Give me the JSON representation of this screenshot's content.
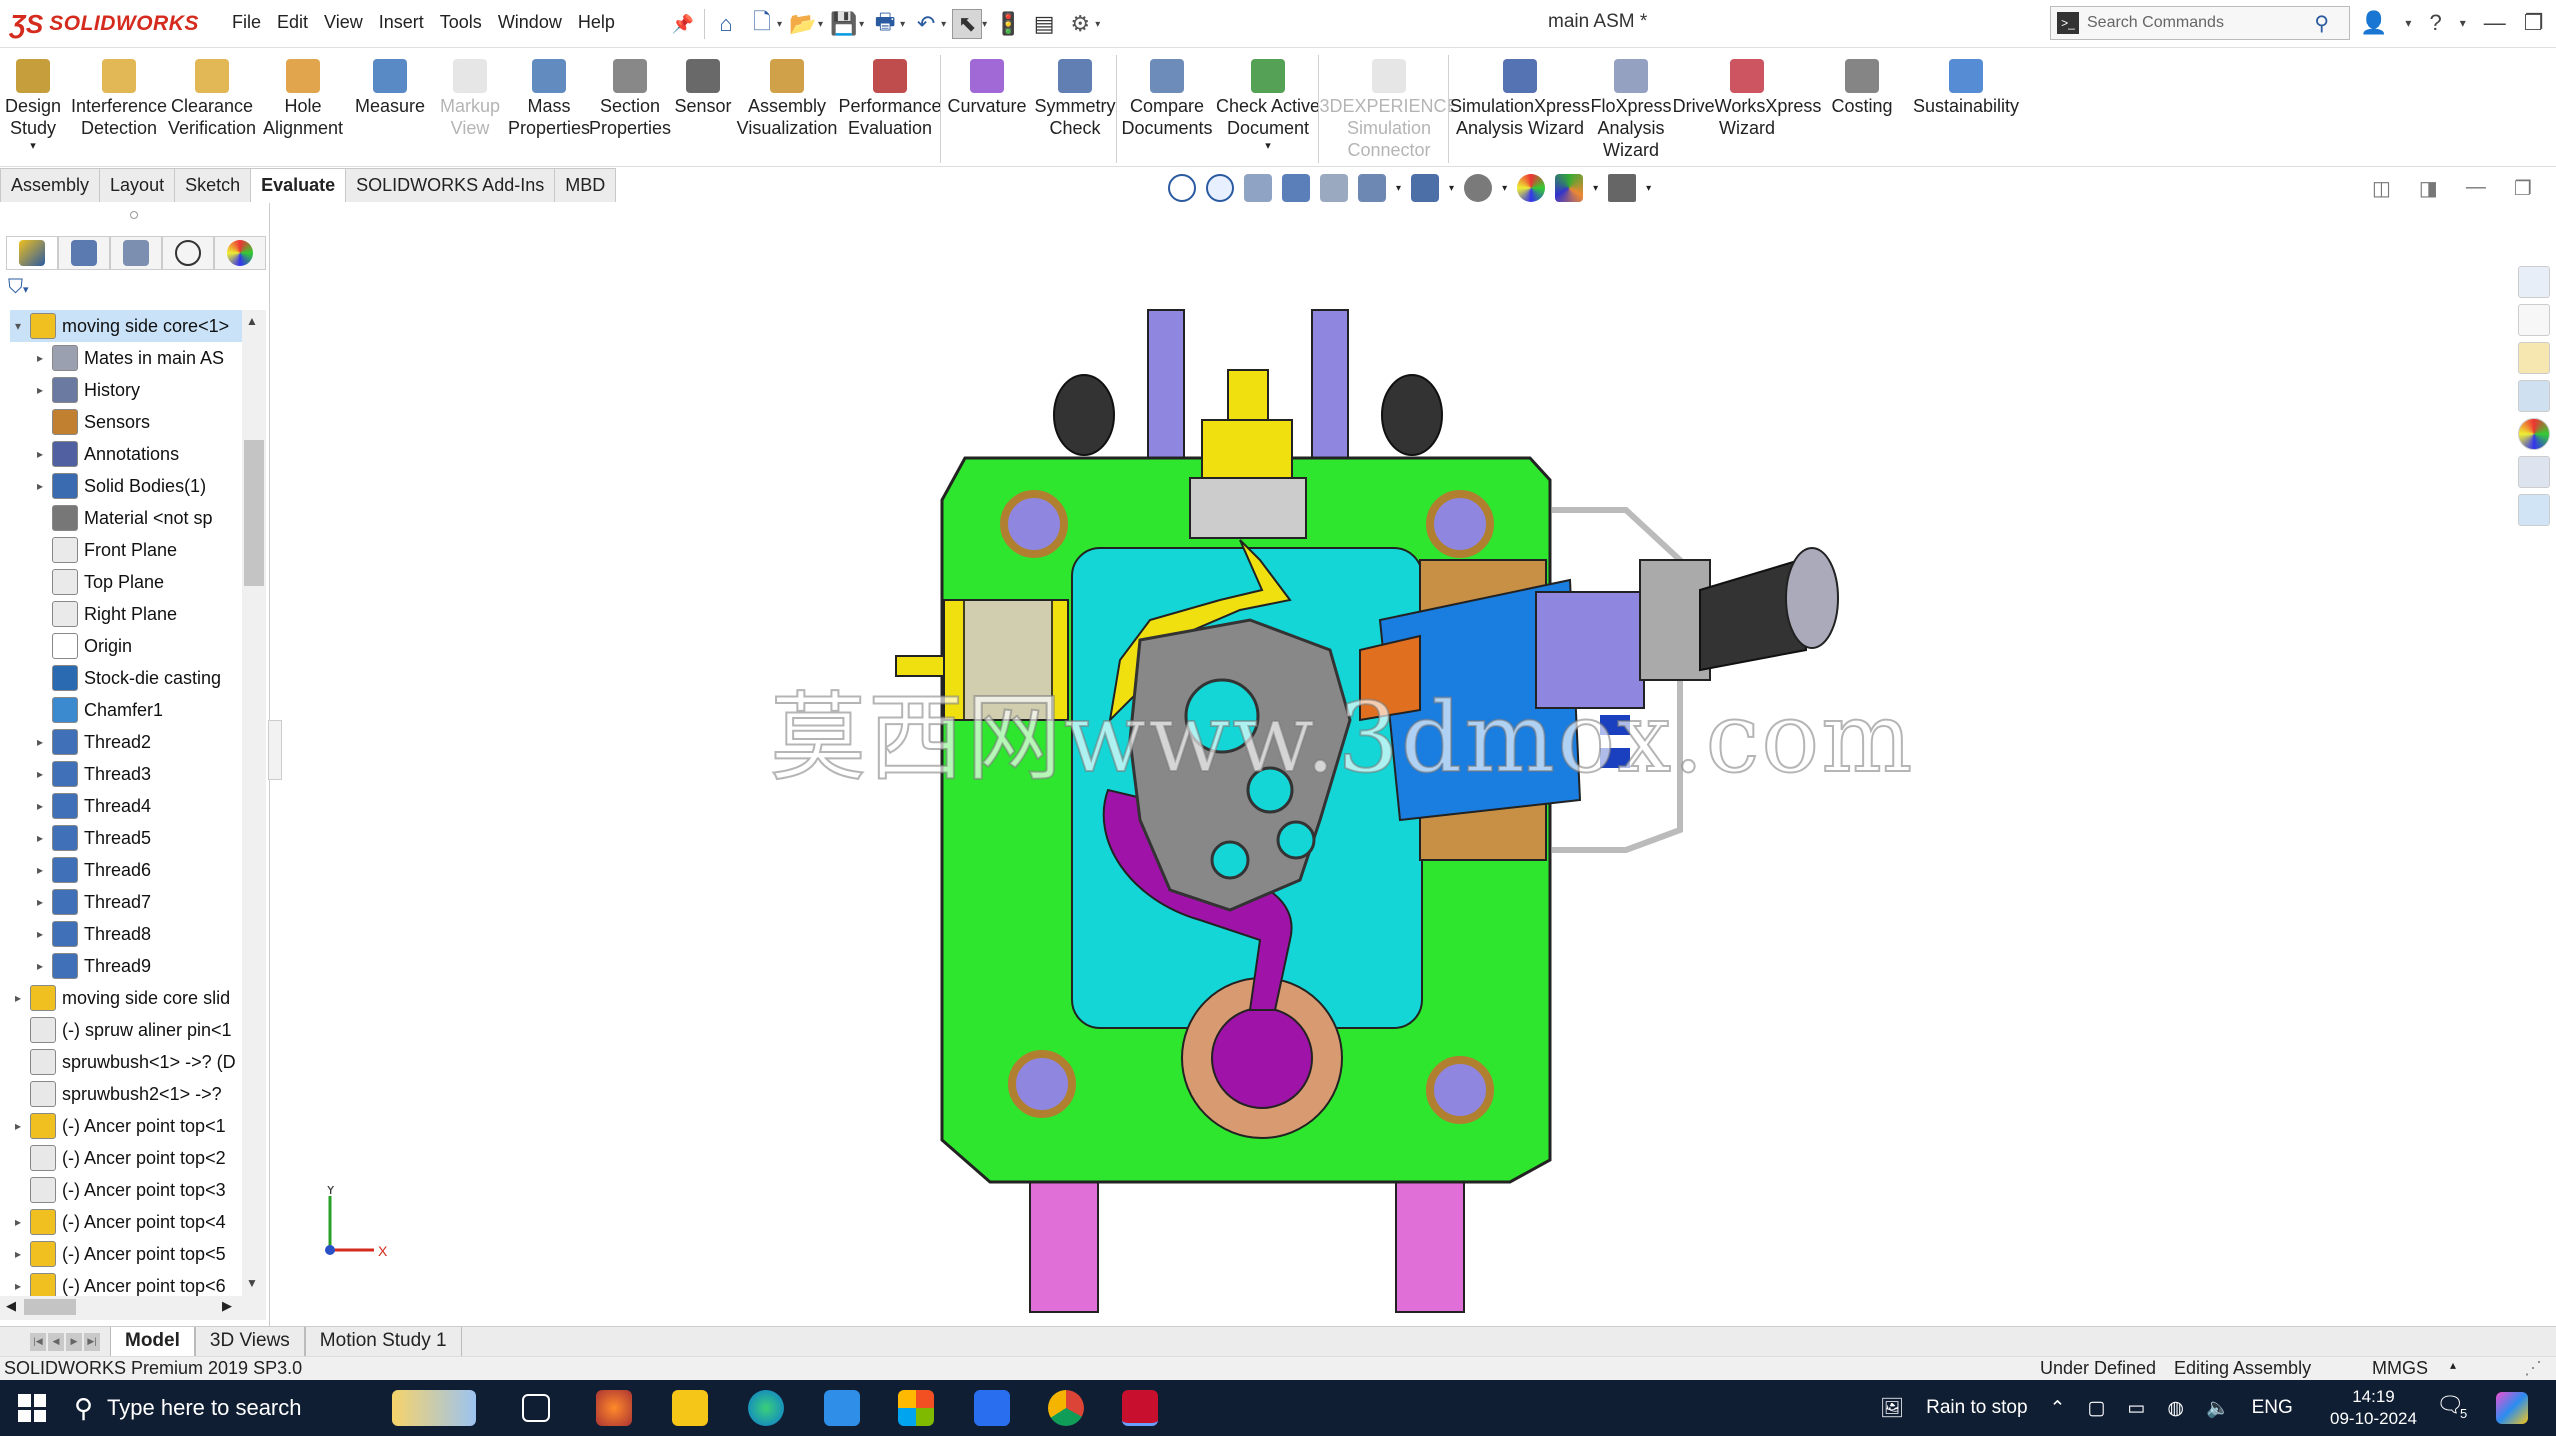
{
  "app": {
    "brand": "SOLIDWORKS",
    "doc_title": "main ASM *"
  },
  "menu": [
    "File",
    "Edit",
    "View",
    "Insert",
    "Tools",
    "Window",
    "Help"
  ],
  "search": {
    "placeholder": "Search Commands"
  },
  "commands": [
    {
      "label": "Design\nStudy",
      "icon": "design-study-icon",
      "enabled": true
    },
    {
      "label": "Interference\nDetection",
      "icon": "interference-detection-icon",
      "enabled": true
    },
    {
      "label": "Clearance\nVerification",
      "icon": "clearance-verification-icon",
      "enabled": true
    },
    {
      "label": "Hole\nAlignment",
      "icon": "hole-alignment-icon",
      "enabled": true
    },
    {
      "label": "Measure",
      "icon": "measure-icon",
      "enabled": true
    },
    {
      "label": "Markup\nView",
      "icon": "markup-view-icon",
      "enabled": false
    },
    {
      "label": "Mass\nProperties",
      "icon": "mass-properties-icon",
      "enabled": true
    },
    {
      "label": "Section\nProperties",
      "icon": "section-properties-icon",
      "enabled": true
    },
    {
      "label": "Sensor",
      "icon": "sensor-icon",
      "enabled": true
    },
    {
      "label": "Assembly\nVisualization",
      "icon": "assembly-visualization-icon",
      "enabled": true
    },
    {
      "label": "Performance\nEvaluation",
      "icon": "performance-evaluation-icon",
      "enabled": true
    },
    {
      "label": "Curvature",
      "icon": "curvature-icon",
      "enabled": true
    },
    {
      "label": "Symmetry\nCheck",
      "icon": "symmetry-check-icon",
      "enabled": true
    },
    {
      "label": "Compare\nDocuments",
      "icon": "compare-documents-icon",
      "enabled": true
    },
    {
      "label": "Check Active\nDocument",
      "icon": "check-active-document-icon",
      "enabled": true
    },
    {
      "label": "3DEXPERIENCE\nSimulation\nConnector",
      "icon": "3dexperience-icon",
      "enabled": false
    },
    {
      "label": "SimulationXpress\nAnalysis Wizard",
      "icon": "simulationxpress-icon",
      "enabled": true
    },
    {
      "label": "FloXpress\nAnalysis\nWizard",
      "icon": "floxpress-icon",
      "enabled": true
    },
    {
      "label": "DriveWorksXpress\nWizard",
      "icon": "driveworksxpress-icon",
      "enabled": true
    },
    {
      "label": "Costing",
      "icon": "costing-icon",
      "enabled": true
    },
    {
      "label": "Sustainability",
      "icon": "sustainability-icon",
      "enabled": true
    }
  ],
  "cm_tabs": [
    "Assembly",
    "Layout",
    "Sketch",
    "Evaluate",
    "SOLIDWORKS Add-Ins",
    "MBD"
  ],
  "cm_active_tab": "Evaluate",
  "tree": [
    {
      "label": "moving side core<1>",
      "level": 0,
      "expander": "▾",
      "icon": "assembly-icon",
      "selected": true
    },
    {
      "label": "Mates in main AS",
      "level": 1,
      "expander": "▸",
      "icon": "mates-icon"
    },
    {
      "label": "History",
      "level": 1,
      "expander": "▸",
      "icon": "history-icon"
    },
    {
      "label": "Sensors",
      "level": 1,
      "expander": "",
      "icon": "sensors-icon"
    },
    {
      "label": "Annotations",
      "level": 1,
      "expander": "▸",
      "icon": "annotations-icon"
    },
    {
      "label": "Solid Bodies(1)",
      "level": 1,
      "expander": "▸",
      "icon": "solid-bodies-icon"
    },
    {
      "label": "Material <not sp",
      "level": 1,
      "expander": "",
      "icon": "material-icon"
    },
    {
      "label": "Front Plane",
      "level": 1,
      "expander": "",
      "icon": "plane-icon"
    },
    {
      "label": "Top Plane",
      "level": 1,
      "expander": "",
      "icon": "plane-icon"
    },
    {
      "label": "Right Plane",
      "level": 1,
      "expander": "",
      "icon": "plane-icon"
    },
    {
      "label": "Origin",
      "level": 1,
      "expander": "",
      "icon": "origin-icon"
    },
    {
      "label": "Stock-die casting",
      "level": 1,
      "expander": "",
      "icon": "feature-icon"
    },
    {
      "label": "Chamfer1",
      "level": 1,
      "expander": "",
      "icon": "chamfer-icon"
    },
    {
      "label": "Thread2",
      "level": 1,
      "expander": "▸",
      "icon": "thread-icon"
    },
    {
      "label": "Thread3",
      "level": 1,
      "expander": "▸",
      "icon": "thread-icon"
    },
    {
      "label": "Thread4",
      "level": 1,
      "expander": "▸",
      "icon": "thread-icon"
    },
    {
      "label": "Thread5",
      "level": 1,
      "expander": "▸",
      "icon": "thread-icon"
    },
    {
      "label": "Thread6",
      "level": 1,
      "expander": "▸",
      "icon": "thread-icon"
    },
    {
      "label": "Thread7",
      "level": 1,
      "expander": "▸",
      "icon": "thread-icon"
    },
    {
      "label": "Thread8",
      "level": 1,
      "expander": "▸",
      "icon": "thread-icon"
    },
    {
      "label": "Thread9",
      "level": 1,
      "expander": "▸",
      "icon": "thread-icon"
    },
    {
      "label": "moving side core slid",
      "level": 0,
      "expander": "▸",
      "icon": "assembly-icon"
    },
    {
      "label": "(-) spruw aliner pin<1",
      "level": 0,
      "expander": "",
      "icon": "part-icon"
    },
    {
      "label": "spruwbush<1> ->? (D",
      "level": 0,
      "expander": "",
      "icon": "part-icon"
    },
    {
      "label": "spruwbush2<1> ->?",
      "level": 0,
      "expander": "",
      "icon": "part-icon"
    },
    {
      "label": "(-) Ancer point top<1",
      "level": 0,
      "expander": "▸",
      "icon": "assembly-icon"
    },
    {
      "label": "(-) Ancer point top<2",
      "level": 0,
      "expander": "",
      "icon": "part-icon"
    },
    {
      "label": "(-) Ancer point top<3",
      "level": 0,
      "expander": "",
      "icon": "part-icon"
    },
    {
      "label": "(-) Ancer point top<4",
      "level": 0,
      "expander": "▸",
      "icon": "assembly-icon"
    },
    {
      "label": "(-) Ancer point top<5",
      "level": 0,
      "expander": "▸",
      "icon": "assembly-icon"
    },
    {
      "label": "(-) Ancer point top<6",
      "level": 0,
      "expander": "▸",
      "icon": "assembly-icon"
    }
  ],
  "watermark": "莫西网www.3dmox.com",
  "triad": {
    "x": "X",
    "y": "Y"
  },
  "bottom_tabs": [
    "Model",
    "3D Views",
    "Motion Study 1"
  ],
  "bottom_active": "Model",
  "status": {
    "version": "SOLIDWORKS Premium 2019 SP3.0",
    "state": "Under Defined",
    "mode": "Editing Assembly",
    "units": "MMGS"
  },
  "taskbar": {
    "search_placeholder": "Type here to search",
    "weather": "Rain to stop",
    "lang": "ENG",
    "time": "14:19",
    "date": "09-10-2024",
    "notifications": "5"
  },
  "colors": {
    "brand": "#d52b1e",
    "plate": "#2ee62e",
    "cavity": "#15d6d6",
    "runner": "#a013a8",
    "slide": "#1a7de0",
    "yellow": "#f0e010",
    "bolt": "#8f86e0",
    "leg": "#e070d8",
    "bronze": "#c89045"
  }
}
